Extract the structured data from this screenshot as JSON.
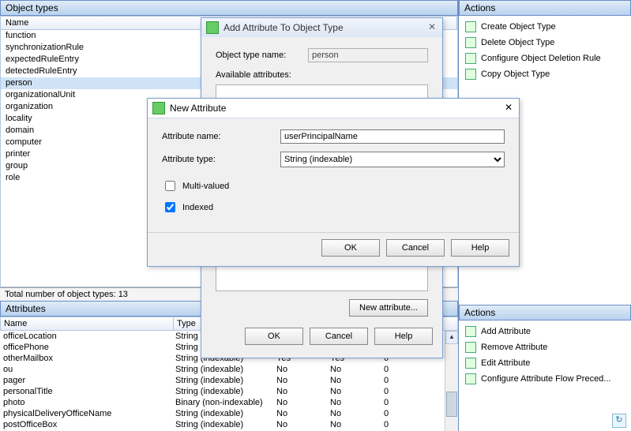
{
  "left": {
    "object_types_header": "Object types",
    "col_name": "Name",
    "types": [
      "function",
      "synchronizationRule",
      "expectedRuleEntry",
      "detectedRuleEntry",
      "person",
      "organizationalUnit",
      "organization",
      "locality",
      "domain",
      "computer",
      "printer",
      "group",
      "role"
    ],
    "selected_index": 4,
    "status_total": "Total number of object types: 13",
    "attributes_header": "Attributes",
    "attr_cols": {
      "name": "Name",
      "type": "Type"
    },
    "attr_rows": [
      {
        "name": "officeLocation",
        "type": "String (indexable)",
        "c3": "",
        "c4": "",
        "c5": ""
      },
      {
        "name": "officePhone",
        "type": "String (indexable)",
        "c3": "",
        "c4": "",
        "c5": ""
      },
      {
        "name": "otherMailbox",
        "type": "String (indexable)",
        "c3": "Yes",
        "c4": "Yes",
        "c5": "0"
      },
      {
        "name": "ou",
        "type": "String (indexable)",
        "c3": "No",
        "c4": "No",
        "c5": "0"
      },
      {
        "name": "pager",
        "type": "String (indexable)",
        "c3": "No",
        "c4": "No",
        "c5": "0"
      },
      {
        "name": "personalTitle",
        "type": "String (indexable)",
        "c3": "No",
        "c4": "No",
        "c5": "0"
      },
      {
        "name": "photo",
        "type": "Binary (non-indexable)",
        "c3": "No",
        "c4": "No",
        "c5": "0"
      },
      {
        "name": "physicalDeliveryOfficeName",
        "type": "String (indexable)",
        "c3": "No",
        "c4": "No",
        "c5": "0"
      },
      {
        "name": "postOfficeBox",
        "type": "String (indexable)",
        "c3": "No",
        "c4": "No",
        "c5": "0"
      }
    ]
  },
  "actions_top": {
    "header": "Actions",
    "items": [
      "Create Object Type",
      "Delete Object Type",
      "Configure Object Deletion Rule",
      "Copy Object Type"
    ]
  },
  "actions_bottom": {
    "header": "Actions",
    "items": [
      "Add Attribute",
      "Remove Attribute",
      "Edit Attribute",
      "Configure Attribute Flow Preced..."
    ]
  },
  "dlg_add_attr": {
    "title": "Add Attribute To Object Type",
    "label_name": "Object type name:",
    "name_value": "person",
    "label_avail": "Available attributes:",
    "btn_new_attr": "New attribute...",
    "btn_ok": "OK",
    "btn_cancel": "Cancel",
    "btn_help": "Help"
  },
  "dlg_new_attr": {
    "title": "New Attribute",
    "label_name": "Attribute name:",
    "name_value": "userPrincipalName",
    "label_type": "Attribute type:",
    "type_value": "String (indexable)",
    "cb_multi": "Multi-valued",
    "cb_indexed": "Indexed",
    "multi_checked": false,
    "indexed_checked": true,
    "btn_ok": "OK",
    "btn_cancel": "Cancel",
    "btn_help": "Help"
  }
}
